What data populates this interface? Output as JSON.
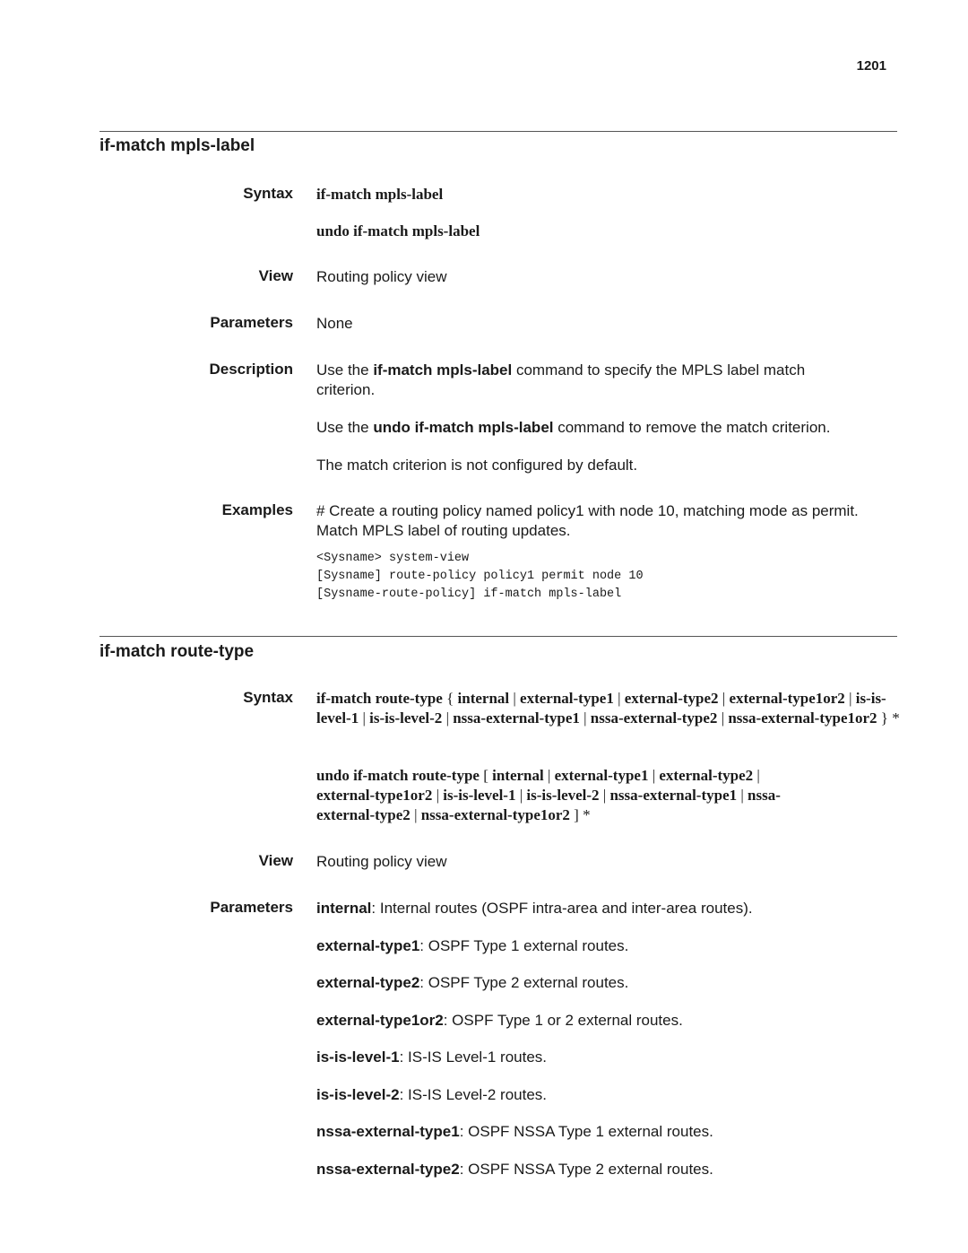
{
  "page_number": "1201",
  "sections": [
    {
      "title": "if-match mpls-label",
      "syntax_label": "Syntax",
      "syntax": [
        "if-match mpls-label",
        "undo if-match mpls-label"
      ],
      "view_label": "View",
      "view": "Routing policy view",
      "parameters_label": "Parameters",
      "parameters": "None",
      "description_label": "Description",
      "description": [
        {
          "pre": "Use the ",
          "bold": "if-match mpls-label",
          "post": " command to specify the MPLS label match criterion."
        },
        {
          "pre": "Use the ",
          "bold": "undo if-match mpls-label",
          "post": " command to remove the match criterion."
        },
        {
          "pre": "The match criterion is not configured by default.",
          "bold": "",
          "post": ""
        }
      ],
      "examples_label": "Examples",
      "examples_text": "# Create a routing policy named policy1 with node 10, matching mode as permit. Match MPLS label of routing updates.",
      "code": [
        "<Sysname> system-view",
        "[Sysname] route-policy policy1 permit node 10",
        "[Sysname-route-policy] if-match mpls-label"
      ]
    },
    {
      "title": "if-match route-type",
      "syntax_label": "Syntax",
      "syntax_1": {
        "cmd": "if-match route-type",
        "open": "{",
        "options": [
          "internal",
          "external-type1",
          "external-type2",
          "external-type1or2",
          "is-is-level-1",
          "is-is-level-2",
          "nssa-external-type1",
          "nssa-external-type2",
          "nssa-external-type1or2"
        ],
        "close": "} *"
      },
      "syntax_2": {
        "cmd": "undo if-match route-type",
        "open": "[",
        "options": [
          "internal",
          "external-type1",
          "external-type2",
          "external-type1or2",
          "is-is-level-1",
          "is-is-level-2",
          "nssa-external-type1",
          "nssa-external-type2",
          "nssa-external-type1or2"
        ],
        "close": "] *"
      },
      "view_label": "View",
      "view": "Routing policy view",
      "parameters_label": "Parameters",
      "parameters": [
        {
          "name": "internal",
          "desc": ": Internal routes (OSPF intra-area and inter-area routes)."
        },
        {
          "name": "external-type1",
          "desc": ": OSPF Type 1 external routes."
        },
        {
          "name": "external-type2",
          "desc": ": OSPF Type 2 external routes."
        },
        {
          "name": "external-type1or2",
          "desc": ": OSPF Type 1 or 2 external routes."
        },
        {
          "name": "is-is-level-1",
          "desc": ": IS-IS Level-1 routes."
        },
        {
          "name": "is-is-level-2",
          "desc": ": IS-IS Level-2 routes."
        },
        {
          "name": "nssa-external-type1",
          "desc": ": OSPF NSSA Type 1 external routes."
        },
        {
          "name": "nssa-external-type2",
          "desc": ": OSPF NSSA Type 2 external routes."
        }
      ]
    }
  ]
}
